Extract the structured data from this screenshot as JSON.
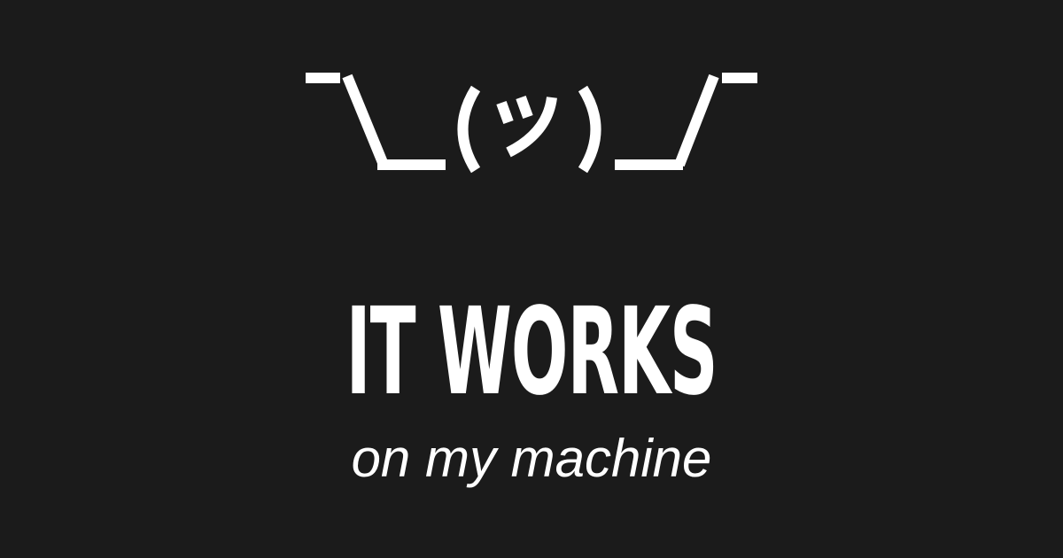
{
  "emoticon": {
    "text": "¯\\_(ツ)_/¯",
    "color": "#ffffff"
  },
  "headline": {
    "text": "IT WORKS"
  },
  "subline": {
    "text": "on my machine"
  },
  "colors": {
    "background": "#1b1b1b",
    "foreground": "#ffffff"
  }
}
